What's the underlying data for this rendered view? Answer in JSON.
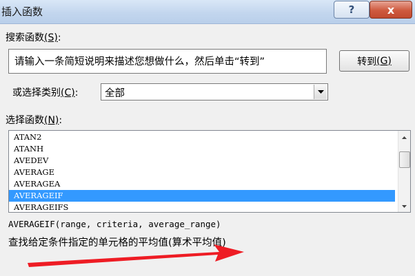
{
  "window": {
    "title": "插入函数",
    "help_label": "?",
    "close_label": "x"
  },
  "search": {
    "label": "搜索函数",
    "accel": "(S)",
    "colon": ":",
    "value": "请输入一条简短说明来描述您想做什么，然后单击“转到”",
    "go_label": "转到",
    "go_accel": "(G)"
  },
  "category": {
    "label": "或选择类别",
    "accel": "(C)",
    "colon": ":",
    "value": "全部"
  },
  "functions": {
    "label": "选择函数",
    "accel": "(N)",
    "colon": ":",
    "items": [
      "ATAN2",
      "ATANH",
      "AVEDEV",
      "AVERAGE",
      "AVERAGEA",
      "AVERAGEIF",
      "AVERAGEIFS"
    ],
    "selected_index": 5,
    "syntax": "AVERAGEIF(range, criteria, average_range)",
    "description": "查找给定条件指定的单元格的平均值(算术平均值)"
  },
  "colors": {
    "selection": "#3399ff",
    "annotation_arrow": "#ee1c24"
  },
  "icons": {
    "dropdown": "triangle-down",
    "scroll_up": "triangle-up",
    "scroll_down": "triangle-down"
  }
}
